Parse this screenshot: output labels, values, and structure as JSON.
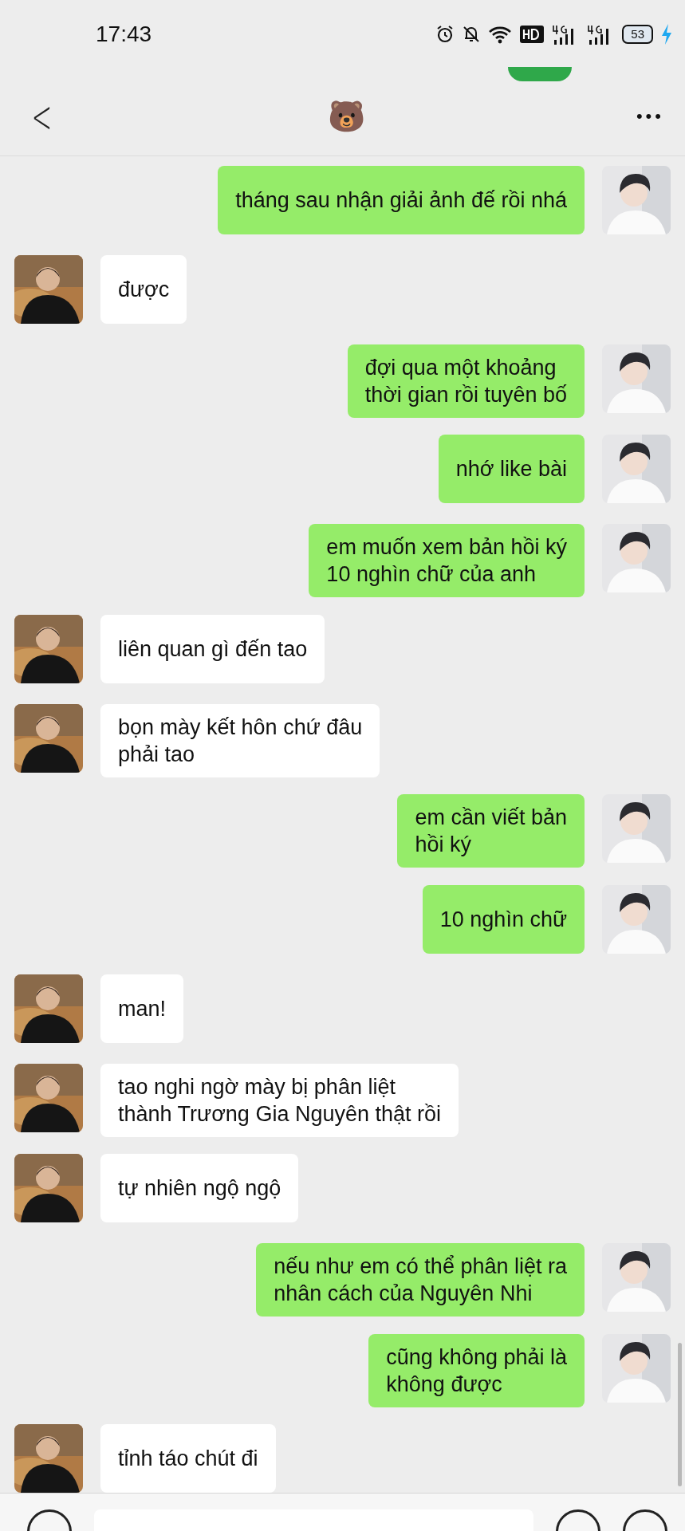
{
  "status_bar": {
    "time": "17:43",
    "battery": "53"
  },
  "header": {
    "title": "🐻",
    "back": "<",
    "more": "•••"
  },
  "messages": [
    {
      "kind": "sent",
      "text": "tháng sau nhận giải ảnh đế rồi nhá"
    },
    {
      "kind": "received",
      "text": "được"
    },
    {
      "kind": "sent",
      "text": "đợi qua một khoảng\nthời gian rồi tuyên bố"
    },
    {
      "kind": "sent",
      "text": "nhớ like bài"
    },
    {
      "kind": "sent",
      "text": "em muốn xem bản hồi ký\n10 nghìn chữ của anh"
    },
    {
      "kind": "received",
      "text": "liên quan gì đến tao"
    },
    {
      "kind": "received",
      "text": "bọn mày kết hôn chứ đâu\nphải tao"
    },
    {
      "kind": "sent",
      "text": "em cần viết bản\nhồi ký"
    },
    {
      "kind": "sent",
      "text": "10 nghìn chữ"
    },
    {
      "kind": "received",
      "text": "man!"
    },
    {
      "kind": "received",
      "text": "tao nghi ngờ mày bị phân liệt\nthành Trương Gia Nguyên thật rồi"
    },
    {
      "kind": "received",
      "text": "tự nhiên ngộ ngộ"
    },
    {
      "kind": "sent",
      "text": "nếu như em có thể phân liệt ra\nnhân cách của Nguyên Nhi"
    },
    {
      "kind": "sent",
      "text": "cũng không phải là\nkhông được"
    },
    {
      "kind": "received",
      "text": "tỉnh táo chút đi"
    }
  ]
}
